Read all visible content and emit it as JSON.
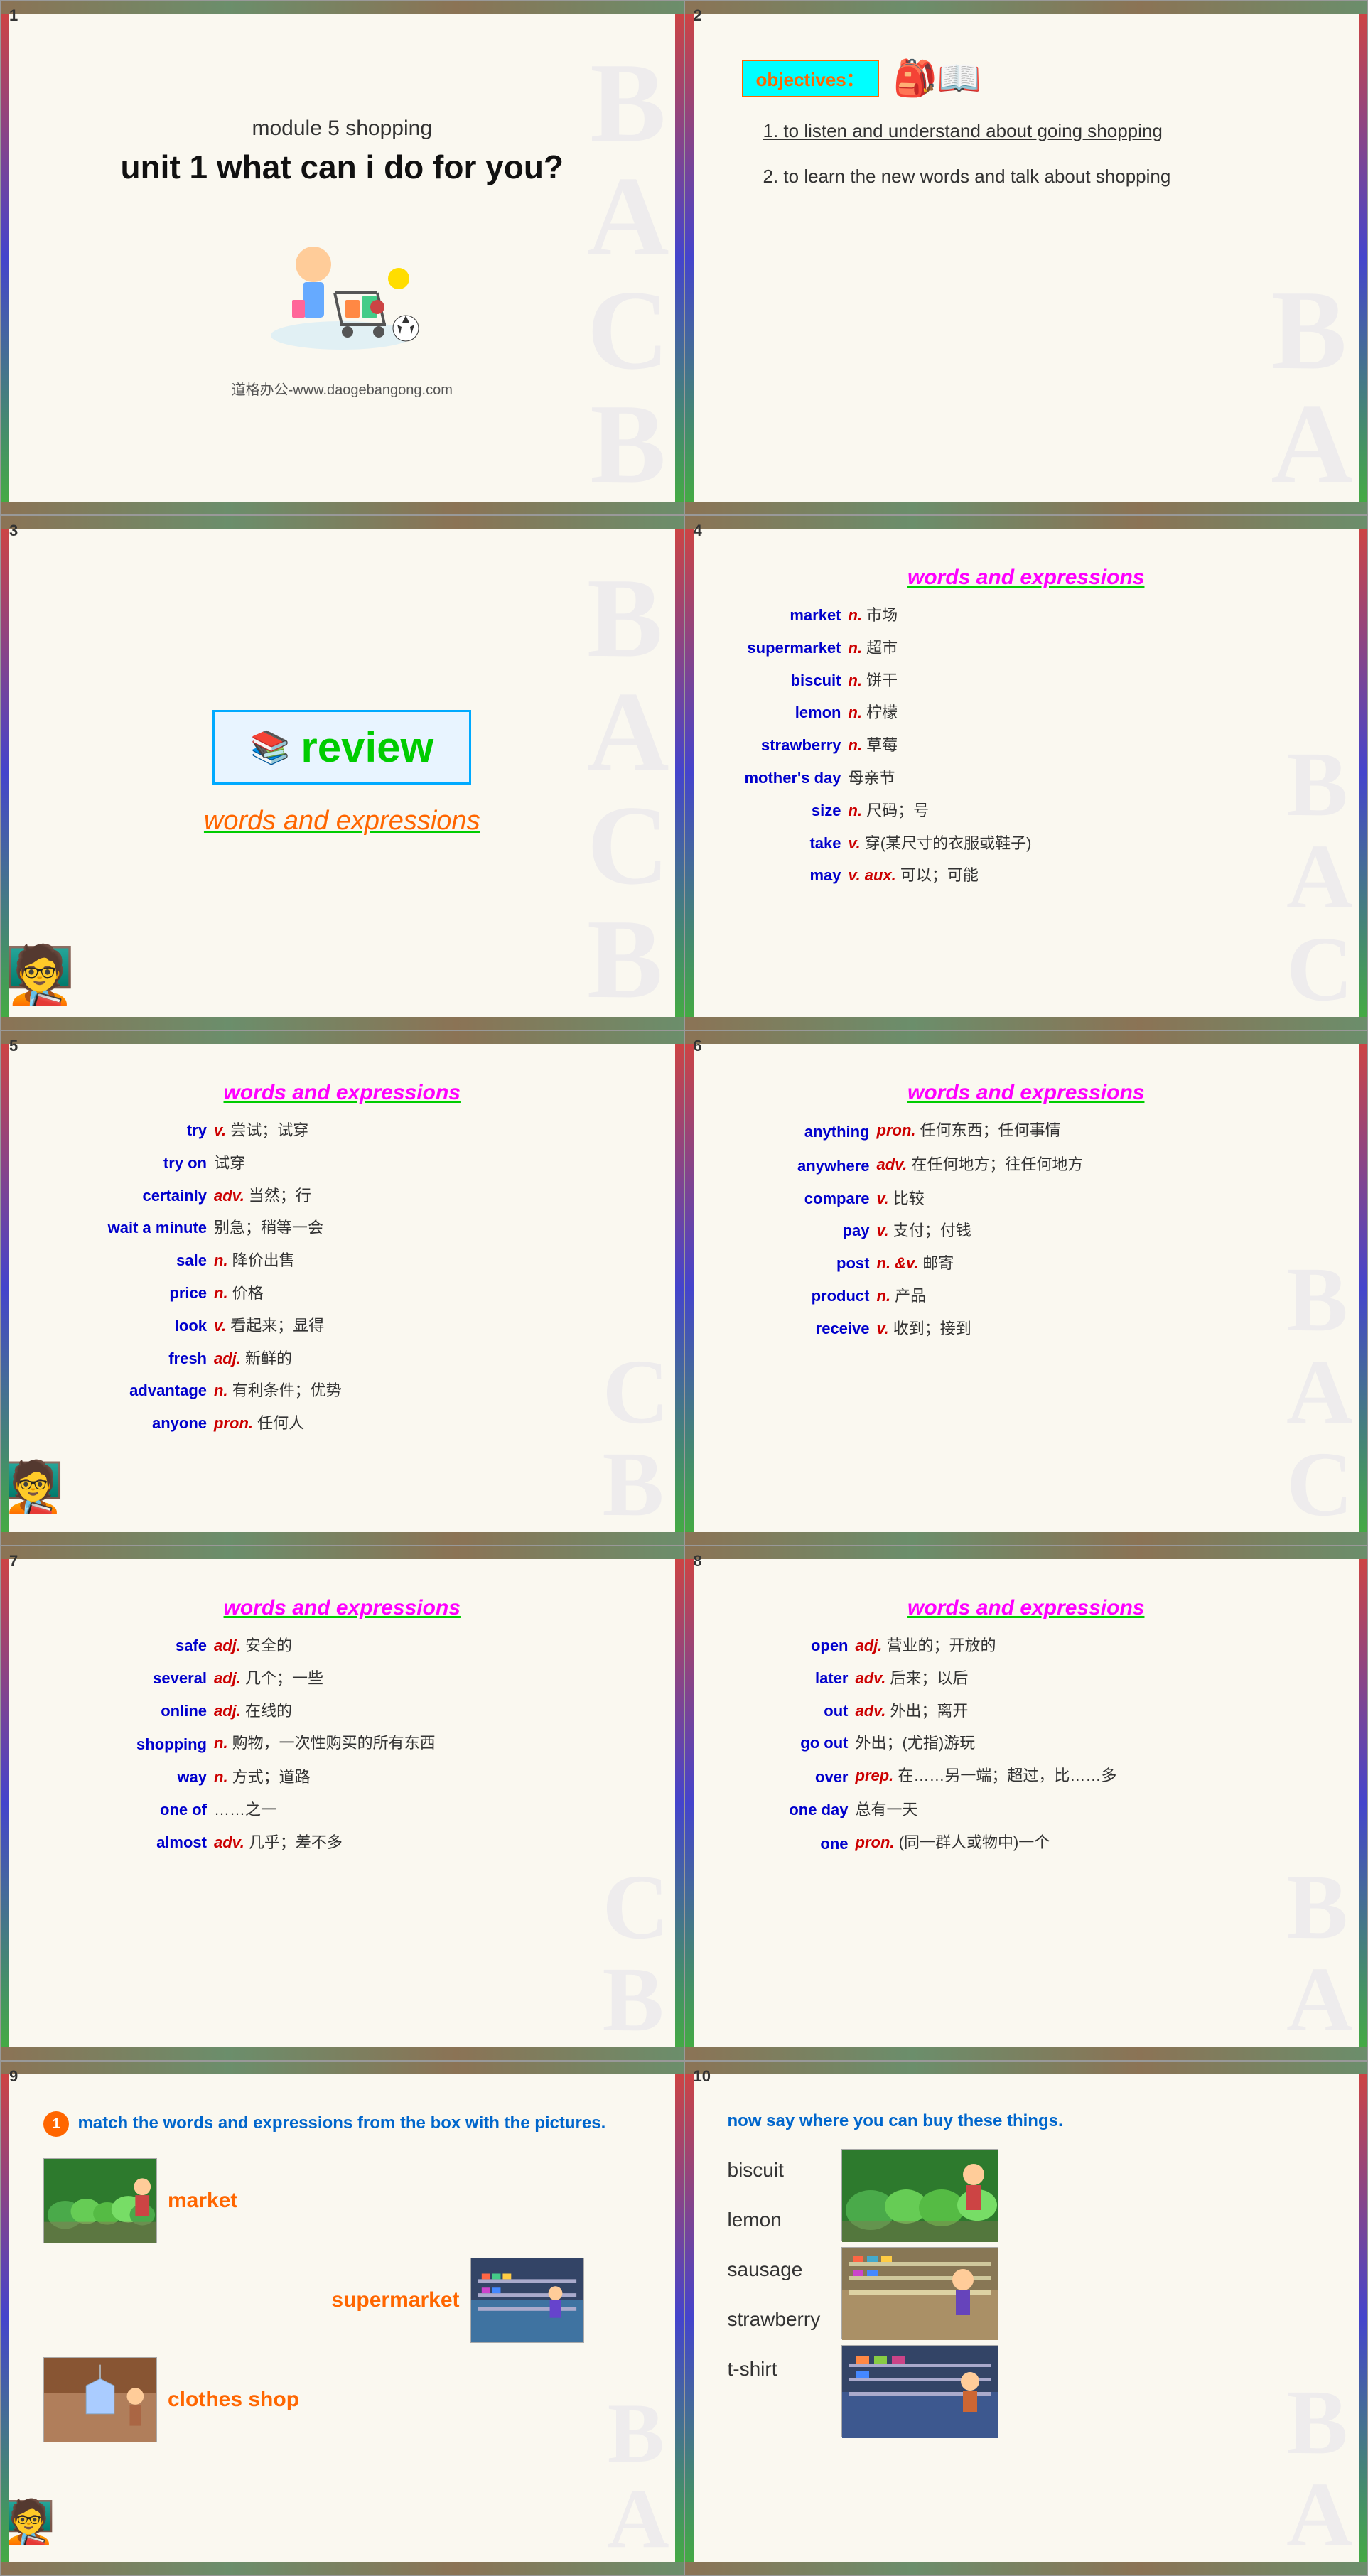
{
  "slides": [
    {
      "number": "1",
      "module": "module 5  shopping",
      "title": "unit 1 what can i do for you?",
      "website": "道格办公-www.daogebangong.com"
    },
    {
      "number": "2",
      "objectives_label": "objectives：",
      "items": [
        "1. to listen and understand about going shopping",
        "2. to learn the new words and talk about shopping"
      ]
    },
    {
      "number": "3",
      "review_label": "review",
      "subtitle": "words and expressions"
    },
    {
      "number": "4",
      "section_title": "words and expressions",
      "words": [
        {
          "key": "market",
          "pos": "n.",
          "def": "市场"
        },
        {
          "key": "supermarket",
          "pos": "n.",
          "def": "超市"
        },
        {
          "key": "biscuit",
          "pos": "n.",
          "def": "饼干"
        },
        {
          "key": "lemon",
          "pos": "n.",
          "def": "柠檬"
        },
        {
          "key": "strawberry",
          "pos": "n.",
          "def": "草莓"
        },
        {
          "key": "mother's day",
          "pos": "",
          "def": "母亲节"
        },
        {
          "key": "size",
          "pos": "n.",
          "def": "尺码；号"
        },
        {
          "key": "take",
          "pos": "v.",
          "def": "穿(某尺寸的衣服或鞋子)"
        },
        {
          "key": "may",
          "pos": "v. aux.",
          "def": "可以；可能"
        }
      ]
    },
    {
      "number": "5",
      "section_title": "words and expressions",
      "words": [
        {
          "key": "try",
          "pos": "v.",
          "def": "尝试；试穿"
        },
        {
          "key": "try on",
          "pos": "",
          "def": "试穿"
        },
        {
          "key": "certainly",
          "pos": "adv.",
          "def": "当然；行"
        },
        {
          "key": "wait a minute",
          "pos": "",
          "def": "别急；稍等一会"
        },
        {
          "key": "sale",
          "pos": "n.",
          "def": "降价出售"
        },
        {
          "key": "price",
          "pos": "n.",
          "def": "价格"
        },
        {
          "key": "look",
          "pos": "v.",
          "def": "看起来；显得"
        },
        {
          "key": "fresh",
          "pos": "adj.",
          "def": "新鲜的"
        },
        {
          "key": "advantage",
          "pos": "n.",
          "def": "有利条件；优势"
        },
        {
          "key": "anyone",
          "pos": "pron.",
          "def": "任何人"
        }
      ]
    },
    {
      "number": "6",
      "section_title": "words and expressions",
      "words": [
        {
          "key": "anything",
          "pos": "pron.",
          "def": "任何东西；任何事情"
        },
        {
          "key": "anywhere",
          "pos": "adv.",
          "def": "在任何地方；往任何地方"
        },
        {
          "key": "compare",
          "pos": "v.",
          "def": "比较"
        },
        {
          "key": "pay",
          "pos": "v.",
          "def": "支付；付钱"
        },
        {
          "key": "post",
          "pos": "n. &v.",
          "def": "邮寄"
        },
        {
          "key": "product",
          "pos": "n.",
          "def": "产品"
        },
        {
          "key": "receive",
          "pos": "v.",
          "def": "收到；接到"
        }
      ]
    },
    {
      "number": "7",
      "section_title": "words and expressions",
      "words": [
        {
          "key": "safe",
          "pos": "adj.",
          "def": "安全的"
        },
        {
          "key": "several",
          "pos": "adj.",
          "def": "几个；一些"
        },
        {
          "key": "online",
          "pos": "adj.",
          "def": "在线的"
        },
        {
          "key": "shopping",
          "pos": "n.",
          "def": "购物，一次性购买的所有东西"
        },
        {
          "key": "way",
          "pos": "n.",
          "def": "方式；道路"
        },
        {
          "key": "one of",
          "pos": "",
          "def": "……之一"
        },
        {
          "key": "almost",
          "pos": "adv.",
          "def": "几乎；差不多"
        }
      ]
    },
    {
      "number": "8",
      "section_title": "words and expressions",
      "words": [
        {
          "key": "open",
          "pos": "adj.",
          "def": "营业的；开放的"
        },
        {
          "key": "later",
          "pos": "adv.",
          "def": "后来；以后"
        },
        {
          "key": "out",
          "pos": "adv.",
          "def": "外出；离开"
        },
        {
          "key": "go out",
          "pos": "",
          "def": "外出；(尤指)游玩"
        },
        {
          "key": "over",
          "pos": "prep.",
          "def": "在……另一端；超过，比……多"
        },
        {
          "key": "one day",
          "pos": "",
          "def": "总有一天"
        },
        {
          "key": "one",
          "pos": "pron.",
          "def": "(同一群人或物中)一个"
        }
      ]
    },
    {
      "number": "9",
      "badge": "1",
      "instruction": "match the words and expressions from the box with the pictures.",
      "items": [
        {
          "label": "market",
          "color": "#ff6600"
        },
        {
          "label": "supermarket",
          "color": "#ff6600"
        },
        {
          "label": "clothes shop",
          "color": "#ff6600"
        }
      ]
    },
    {
      "number": "10",
      "instruction": "now say where you can buy these things.",
      "items": [
        "biscuit",
        "lemon",
        "sausage",
        "strawberry",
        "t-shirt"
      ]
    }
  ]
}
